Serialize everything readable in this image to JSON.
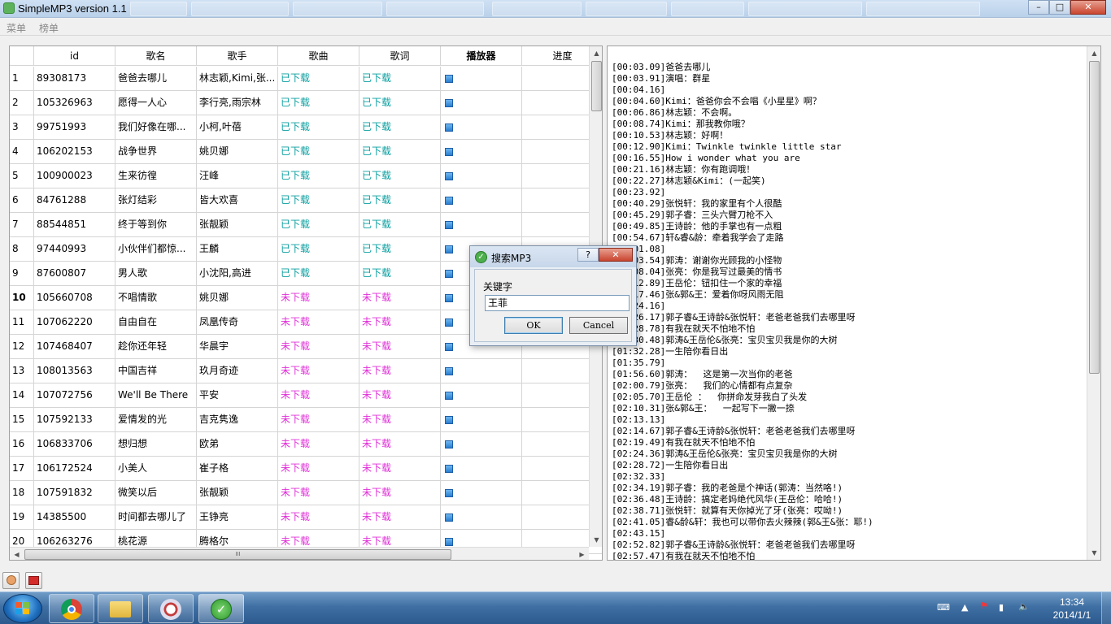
{
  "window": {
    "title": "SimpleMP3 version 1.1",
    "min_label": "–",
    "max_label": "□",
    "close_label": "✕"
  },
  "menu": [
    {
      "label": "菜单"
    },
    {
      "label": "榜单"
    }
  ],
  "table": {
    "headers": {
      "id": "id",
      "name": "歌名",
      "artist": "歌手",
      "song": "歌曲",
      "lyric": "歌词",
      "player": "播放器",
      "progress": "进度"
    },
    "current_row": 10,
    "rows": [
      {
        "n": "1",
        "id": "89308173",
        "name": "爸爸去哪儿",
        "artist": "林志颖,Kimi,张...",
        "song": "已下载",
        "lyric": "已下载",
        "downloaded": true
      },
      {
        "n": "2",
        "id": "105326963",
        "name": "愿得一人心",
        "artist": "李行亮,雨宗林",
        "song": "已下载",
        "lyric": "已下载",
        "downloaded": true
      },
      {
        "n": "3",
        "id": "99751993",
        "name": "我们好像在哪...",
        "artist": "小柯,叶蓓",
        "song": "已下载",
        "lyric": "已下载",
        "downloaded": true
      },
      {
        "n": "4",
        "id": "106202153",
        "name": "战争世界",
        "artist": "姚贝娜",
        "song": "已下载",
        "lyric": "已下载",
        "downloaded": true
      },
      {
        "n": "5",
        "id": "100900023",
        "name": "生来彷徨",
        "artist": "汪峰",
        "song": "已下载",
        "lyric": "已下载",
        "downloaded": true
      },
      {
        "n": "6",
        "id": "84761288",
        "name": "张灯结彩",
        "artist": "皆大欢喜",
        "song": "已下载",
        "lyric": "已下载",
        "downloaded": true
      },
      {
        "n": "7",
        "id": "88544851",
        "name": "终于等到你",
        "artist": "张靓颖",
        "song": "已下载",
        "lyric": "已下载",
        "downloaded": true
      },
      {
        "n": "8",
        "id": "97440993",
        "name": "小伙伴们都惊...",
        "artist": "王麟",
        "song": "已下载",
        "lyric": "已下载",
        "downloaded": true
      },
      {
        "n": "9",
        "id": "87600807",
        "name": "男人歌",
        "artist": "小沈阳,高进",
        "song": "已下载",
        "lyric": "已下载",
        "downloaded": true
      },
      {
        "n": "10",
        "id": "105660708",
        "name": "不唱情歌",
        "artist": "姚贝娜",
        "song": "未下载",
        "lyric": "未下载",
        "downloaded": false
      },
      {
        "n": "11",
        "id": "107062220",
        "name": "自由自在",
        "artist": "凤凰传奇",
        "song": "未下载",
        "lyric": "未下载",
        "downloaded": false
      },
      {
        "n": "12",
        "id": "107468407",
        "name": "趁你还年轻",
        "artist": "华晨宇",
        "song": "未下载",
        "lyric": "未下载",
        "downloaded": false
      },
      {
        "n": "13",
        "id": "108013563",
        "name": "中国吉祥",
        "artist": "玖月奇迹",
        "song": "未下载",
        "lyric": "未下载",
        "downloaded": false
      },
      {
        "n": "14",
        "id": "107072756",
        "name": "We'll Be There",
        "artist": "平安",
        "song": "未下载",
        "lyric": "未下载",
        "downloaded": false
      },
      {
        "n": "15",
        "id": "107592133",
        "name": "爱情发的光",
        "artist": "吉克隽逸",
        "song": "未下载",
        "lyric": "未下载",
        "downloaded": false
      },
      {
        "n": "16",
        "id": "106833706",
        "name": "想归想",
        "artist": "欧弟",
        "song": "未下载",
        "lyric": "未下载",
        "downloaded": false
      },
      {
        "n": "17",
        "id": "106172524",
        "name": "小美人",
        "artist": "崔子格",
        "song": "未下载",
        "lyric": "未下载",
        "downloaded": false
      },
      {
        "n": "18",
        "id": "107591832",
        "name": "微笑以后",
        "artist": "张靓颖",
        "song": "未下载",
        "lyric": "未下载",
        "downloaded": false
      },
      {
        "n": "19",
        "id": "14385500",
        "name": "时间都去哪儿了",
        "artist": "王铮亮",
        "song": "未下载",
        "lyric": "未下载",
        "downloaded": false
      },
      {
        "n": "20",
        "id": "106263276",
        "name": "桃花源",
        "artist": "腾格尔",
        "song": "未下载",
        "lyric": "未下载",
        "downloaded": false
      }
    ],
    "hscroll_label": "III"
  },
  "lyrics": [
    "[00:03.09]爸爸去哪儿",
    "[00:03.91]演唱：群星",
    "[00:04.16]",
    "[00:04.60]Kimi：爸爸你会不会唱《小星星》啊？",
    "[00:06.86]林志颖：不会啊。",
    "[00:08.74]Kimi：那我教你哦？",
    "[00:10.53]林志颖：好啊！",
    "[00:12.90]Kimi：Twinkle twinkle little star",
    "[00:16.55]How i wonder what you are",
    "[00:21.16]林志颖：你有跑调哦！",
    "[00:22.27]林志颖&Kimi：(一起笑)",
    "[00:23.92]",
    "[00:40.29]张悦轩：我的家里有个人很酷",
    "[00:45.29]郭子睿：三头六臂刀枪不入",
    "[00:49.85]王诗龄：他的手掌也有一点粗",
    "[00:54.67]轩&睿&龄：牵着我学会了走路",
    "[01:01.08]",
    "[01:03.54]郭涛：谢谢你光顾我的小怪物",
    "[01:08.04]张亮：你是我写过最美的情书",
    "[01:12.89]王岳伦：钮扣住一个家的幸福",
    "[01:17.46]张&郭&王：爱着你呀风雨无阻",
    "[01:24.16]",
    "[01:26.17]郭子睿&王诗龄&张悦轩：老爸老爸我们去哪里呀",
    "[01:28.78]有我在就天不怕地不怕",
    "[01:30.48]郭涛&王岳伦&张亮：宝贝宝贝我是你的大树",
    "[01:32.28]一生陪你看日出",
    "[01:35.79]",
    "[01:56.60]郭涛：  这是第一次当你的老爸",
    "[02:00.79]张亮：  我们的心情都有点复杂",
    "[02:05.70]王岳伦 ：  你拼命发芽我白了头发",
    "[02:10.31]张&郭&王：  一起写下一撇一捺",
    "[02:13.13]",
    "[02:14.67]郭子睿&王诗龄&张悦轩：老爸老爸我们去哪里呀",
    "[02:19.49]有我在就天不怕地不怕",
    "[02:24.36]郭涛&王岳伦&张亮：宝贝宝贝我是你的大树",
    "[02:28.72]一生陪你看日出",
    "[02:32.33]",
    "[02:34.19]郭子睿：我的老爸是个神话(郭涛：当然咯!)",
    "[02:36.48]王诗龄：搞定老妈绝代风华(王岳伦：哈哈!)",
    "[02:38.71]张悦轩：就算有天你掉光了牙(张亮：哎呦!)",
    "[02:41.05]睿&龄&轩：我也可以带你去火辣辣(郭&王&张：耶!)",
    "[02:43.15]",
    "[02:52.82]郭子睿&王诗龄&张悦轩：老爸老爸我们去哪里呀",
    "[02:57.47]有我在就天不怕地不怕"
  ],
  "dialog": {
    "title": "搜索MP3",
    "help_label": "?",
    "close_label": "✕",
    "field_label": "关键字",
    "field_value": "王菲",
    "ok_label": "OK",
    "cancel_label": "Cancel"
  },
  "bottom_tools": [
    {
      "icon": "user-icon"
    },
    {
      "icon": "gift-icon"
    }
  ],
  "taskbar": {
    "apps": [
      {
        "icon": "chrome-icon"
      },
      {
        "icon": "folder-icon"
      },
      {
        "icon": "tools-icon"
      },
      {
        "icon": "simplemp3-icon"
      }
    ],
    "time": "13:34",
    "date": "2014/1/1"
  }
}
